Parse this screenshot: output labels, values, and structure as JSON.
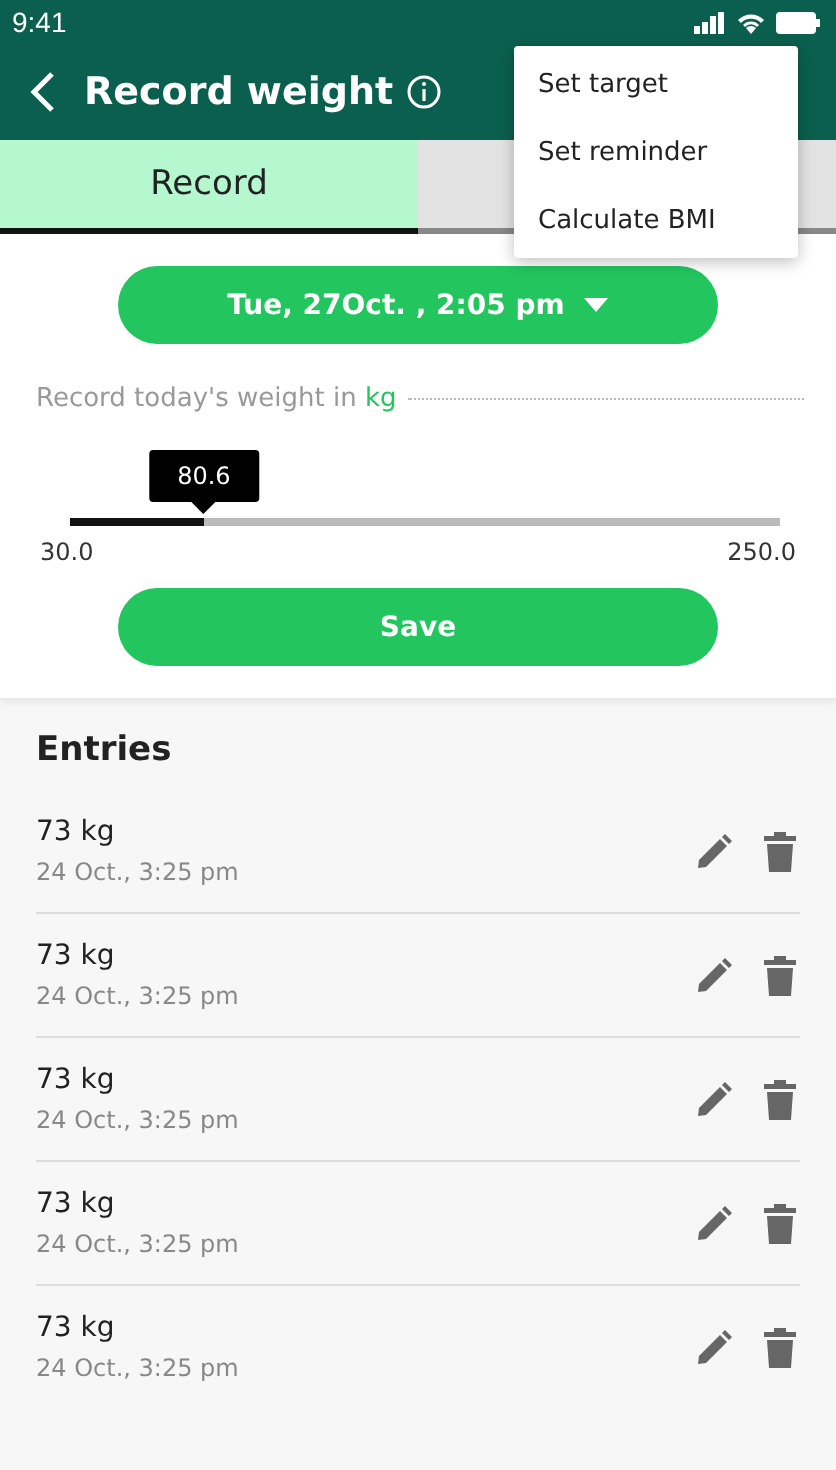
{
  "status_bar": {
    "time": "9:41"
  },
  "header": {
    "title": "Record weight"
  },
  "tabs": [
    {
      "label": "Record",
      "selected": true
    },
    {
      "selected": false
    }
  ],
  "menu": {
    "items": [
      "Set target",
      "Set reminder",
      "Calculate BMI"
    ]
  },
  "date_button": {
    "label": "Tue, 27Oct. , 2:05 pm"
  },
  "prompt": {
    "text": "Record today's weight in ",
    "unit": "kg"
  },
  "slider": {
    "tooltip": "80.6",
    "level": 0.19,
    "min": "30.0",
    "max": "250.0"
  },
  "save_button": {
    "label": "Save"
  },
  "entries": {
    "title": "Entries",
    "items": [
      {
        "weight": "73 kg",
        "time": "24 Oct., 3:25 pm"
      },
      {
        "weight": "73 kg",
        "time": "24 Oct., 3:25 pm"
      },
      {
        "weight": "73 kg",
        "time": "24 Oct., 3:25 pm"
      },
      {
        "weight": "73 kg",
        "time": "24 Oct., 3:25 pm"
      },
      {
        "weight": "73 kg",
        "time": "24 Oct., 3:25 pm"
      }
    ]
  }
}
